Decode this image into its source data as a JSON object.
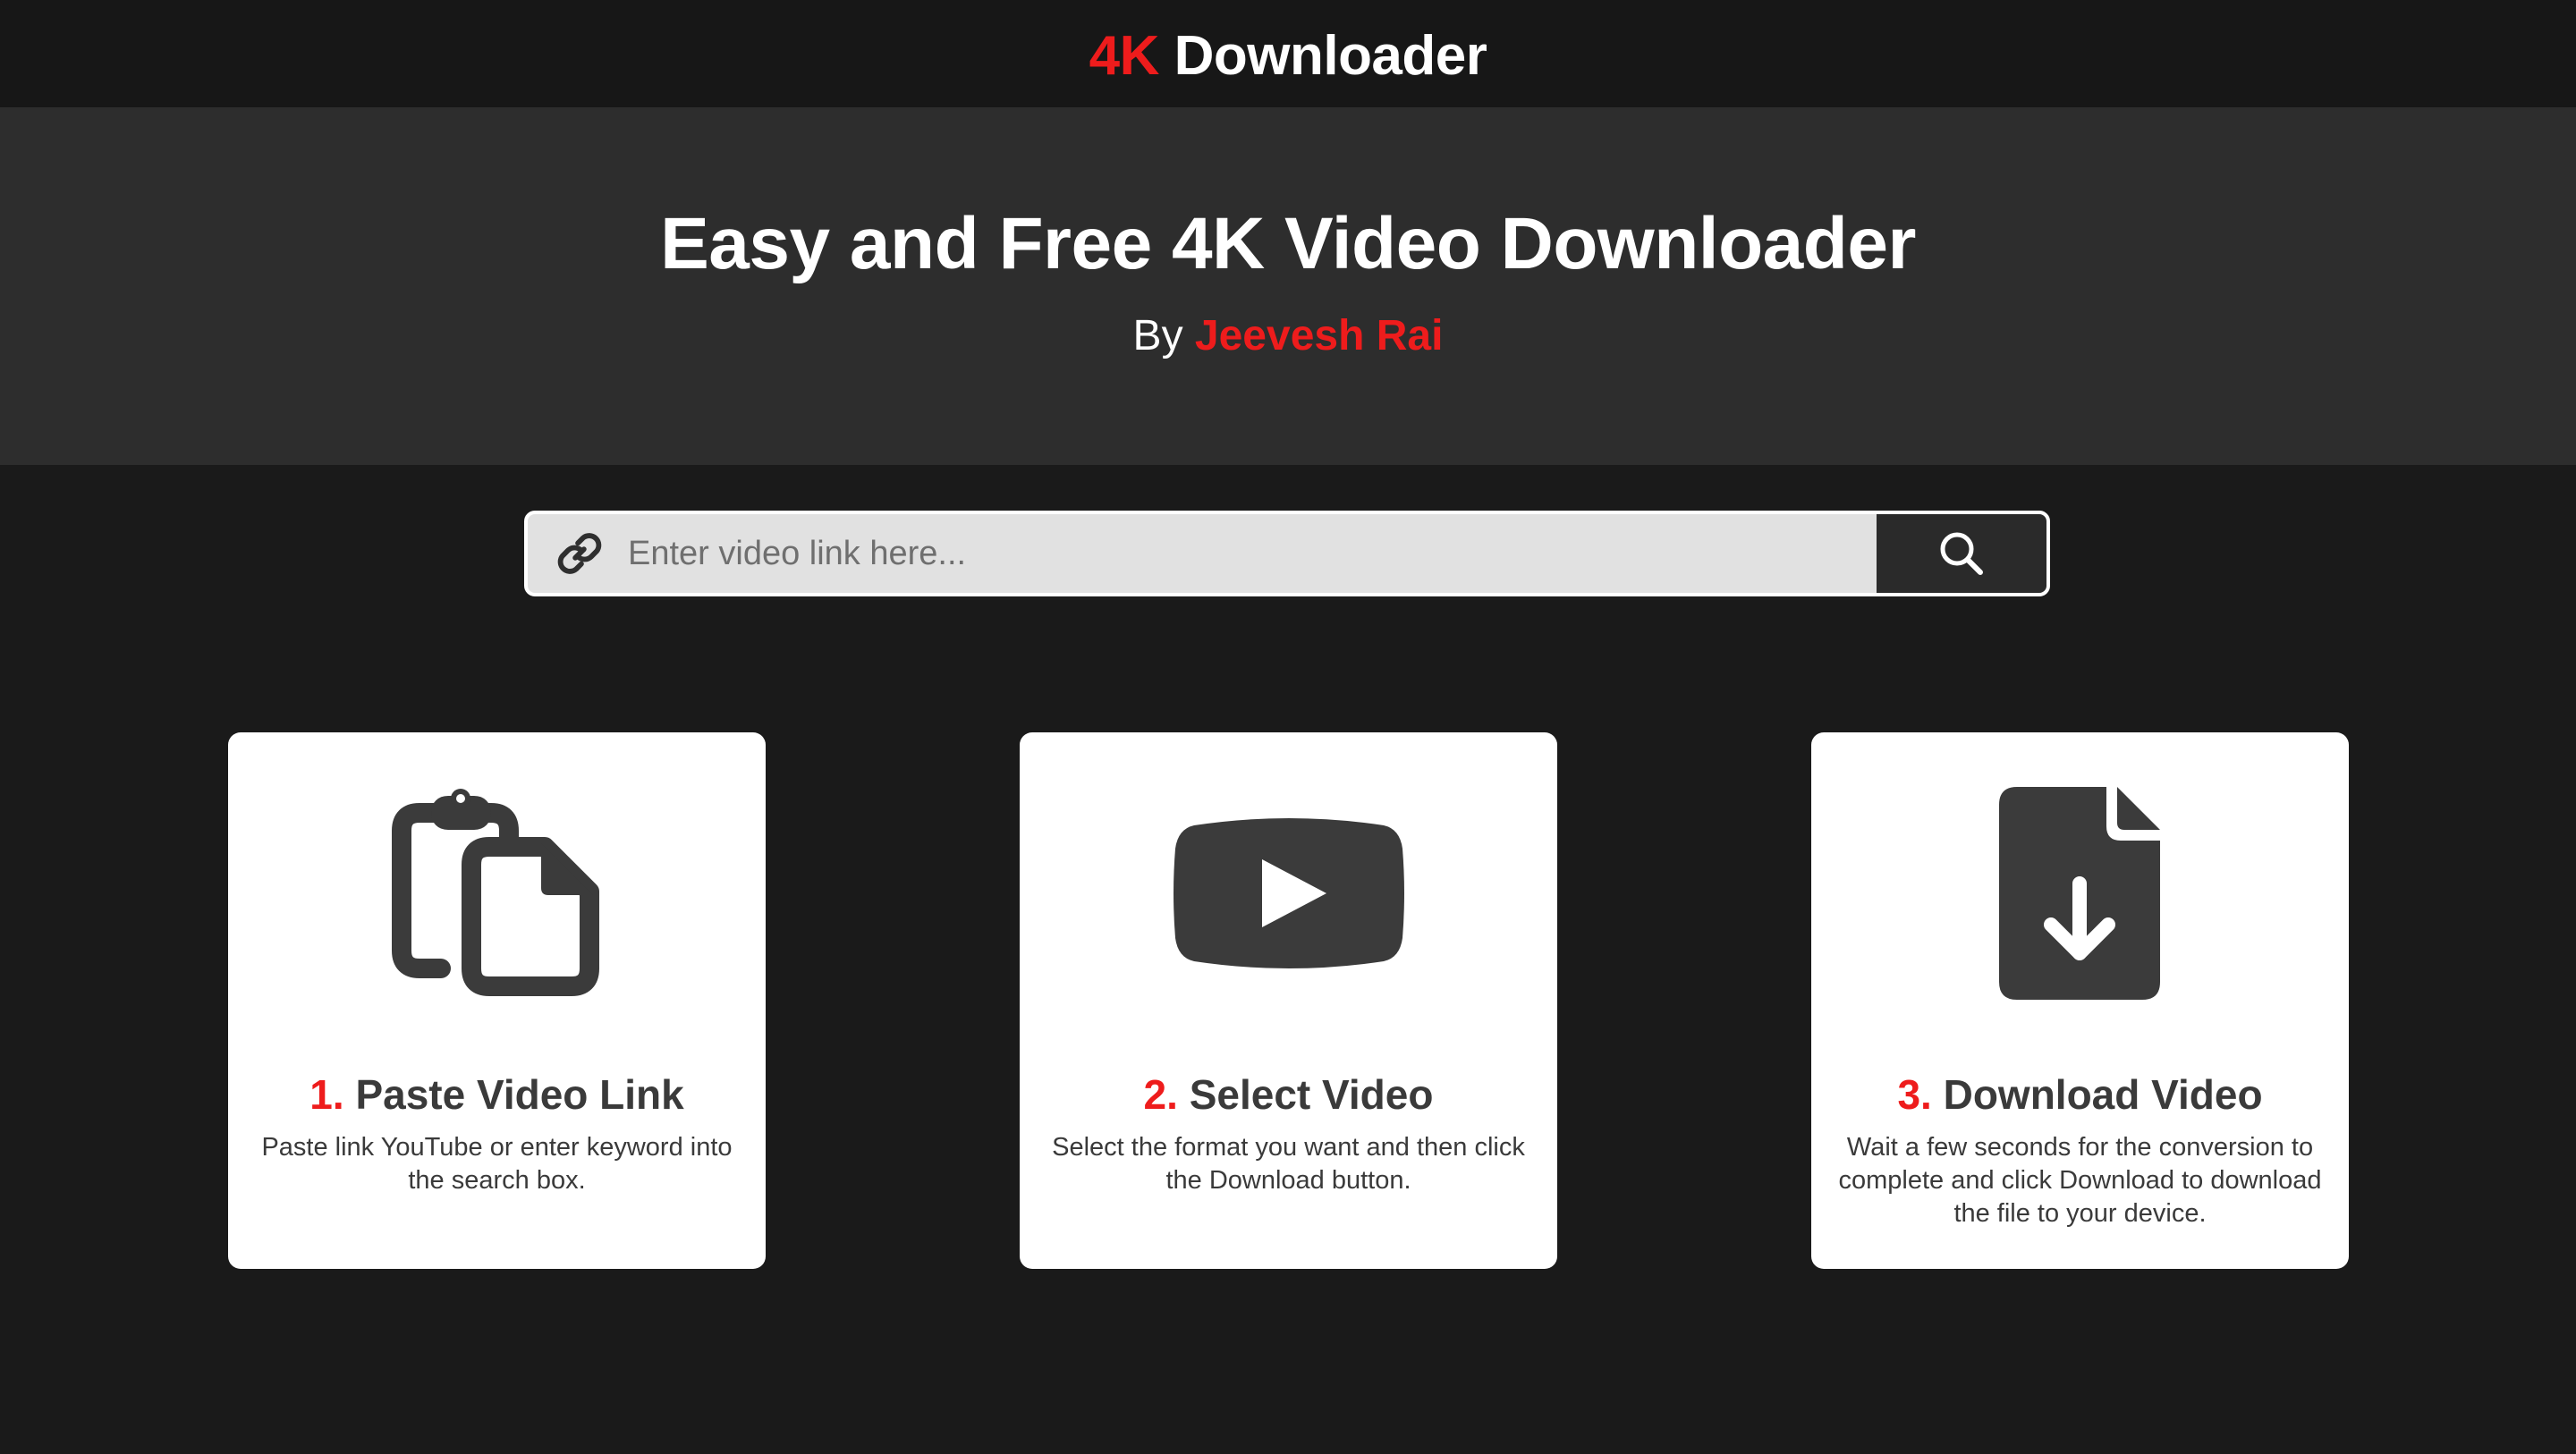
{
  "header": {
    "brand_accent": "4K",
    "brand_rest": "Downloader"
  },
  "hero": {
    "title": "Easy and Free 4K Video Downloader",
    "by_label": "By",
    "author": "Jeevesh Rai"
  },
  "search": {
    "placeholder": "Enter video link here...",
    "value": "",
    "link_icon": "link-icon",
    "button_icon": "search-icon"
  },
  "steps": [
    {
      "number": "1.",
      "title": "Paste Video Link",
      "description": "Paste link YouTube or enter keyword into the search box.",
      "icon": "clipboard-paste-icon"
    },
    {
      "number": "2.",
      "title": "Select Video",
      "description": "Select the format you want and then click the Download button.",
      "icon": "youtube-play-icon"
    },
    {
      "number": "3.",
      "title": "Download Video",
      "description": "Wait a few seconds for the conversion to complete and click Download to download the file to your device.",
      "icon": "file-download-icon"
    }
  ],
  "colors": {
    "accent": "#ee1c1c",
    "background": "#1a1a1a",
    "hero_background": "#2d2d2d",
    "icon_dark": "#3b3b3b"
  }
}
